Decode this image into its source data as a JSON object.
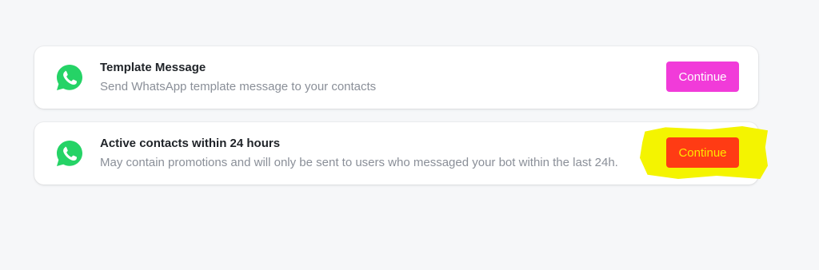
{
  "cards": [
    {
      "icon": "whatsapp-icon",
      "title": "Template Message",
      "description": "Send WhatsApp template message to your contacts",
      "button_label": "Continue",
      "button_color": "#f13bd9"
    },
    {
      "icon": "whatsapp-icon",
      "title": "Active contacts within 24 hours",
      "description": "May contain promotions and will only be sent to users who messaged your bot within the last 24h.",
      "button_label": "Continue",
      "button_color": "#ff3b14",
      "button_text_color": "#ffe600",
      "highlight_color": "#f4f400"
    }
  ],
  "colors": {
    "whatsapp_green": "#25d366",
    "background": "#f6f7f9"
  }
}
